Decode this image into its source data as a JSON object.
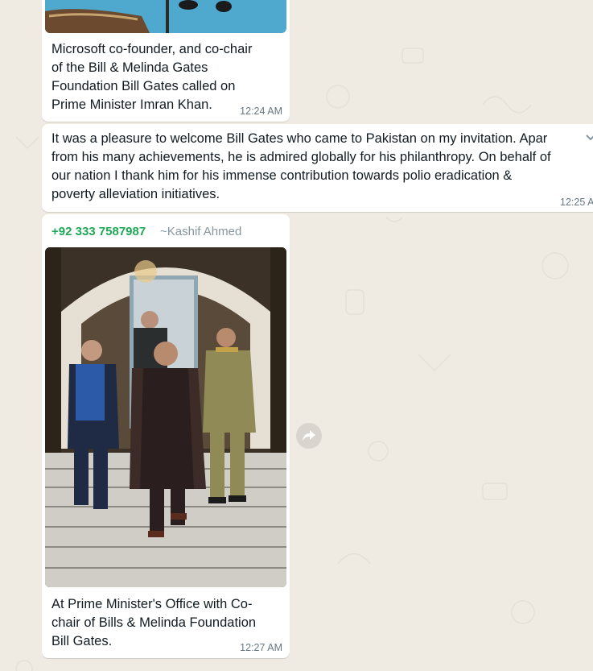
{
  "chat": {
    "messages": [
      {
        "caption": "Microsoft co-founder, and co-chair of the Bill & Melinda Gates Foundation Bill Gates  called on Prime Minister Imran Khan.",
        "caption_lines": [
          "Microsoft co-founder, and co-chair",
          "of the Bill & Melinda Gates",
          "Foundation Bill Gates  called on",
          "Prime Minister Imran Khan."
        ],
        "time": "12:24 AM"
      },
      {
        "text_lines": [
          "It was a pleasure to welcome Bill Gates who came to Pakistan on my invitation. Apar",
          "from his many achievements, he is admired globally for his philanthropy. On behalf of",
          "our nation I thank him for his immense contribution towards polio eradication &",
          "poverty alleviation initiatives."
        ],
        "time": "12:25 A"
      },
      {
        "sender_phone": "+92 333 7587987",
        "sender_alias": "~Kashif Ahmed",
        "caption_lines": [
          "At Prime Minister's Office with Co-",
          "chair of Bills & Melinda Foundation",
          "Bill Gates."
        ],
        "time": "12:27 AM"
      }
    ]
  },
  "icons": {
    "forward": "forward-arrow-icon",
    "chevron": "chevron-down-icon"
  },
  "colors": {
    "chat_bg": "#efeae2",
    "bubble": "#ffffff",
    "sender": "#1fa855",
    "meta": "#667781"
  }
}
